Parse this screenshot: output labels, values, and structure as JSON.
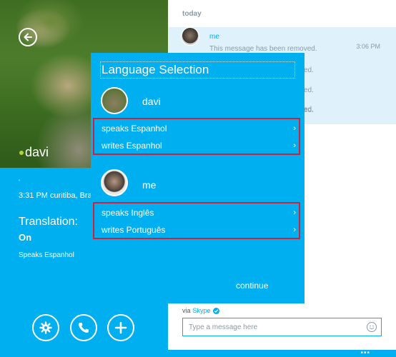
{
  "profile": {
    "name": "davi",
    "small_mark": "’",
    "local_time": "3:31 PM curitiba, Brazil",
    "translation_label": "Translation:",
    "translation_value": "On",
    "speaks": "Speaks Espanhol"
  },
  "chat": {
    "day_label": "today",
    "message": {
      "sender": "me",
      "text": "This message has been removed.",
      "time": "3:06 PM",
      "repeated_lines": [
        "ed.",
        "ed.",
        "ed.",
        "ed."
      ]
    },
    "via_label": "via",
    "via_brand": "Skype",
    "composer_placeholder": "Type a message here",
    "more_label": "•••"
  },
  "language_selection": {
    "title": "Language Selection",
    "people": [
      {
        "name": "davi",
        "speaks_label": "speaks Espanhol",
        "writes_label": "writes Espanhol"
      },
      {
        "name": "me",
        "speaks_label": "speaks Inglês",
        "writes_label": "writes Português"
      }
    ],
    "continue_label": "continue",
    "chevron": "›"
  },
  "colors": {
    "accent": "#00aff0",
    "highlight_box": "#d0203a",
    "message_bg": "#dff2fc",
    "presence": "#b4d334"
  },
  "icons": [
    "back-arrow-icon",
    "settings-icon",
    "call-icon",
    "add-icon",
    "verified-icon",
    "emoji-icon",
    "more-icon"
  ]
}
